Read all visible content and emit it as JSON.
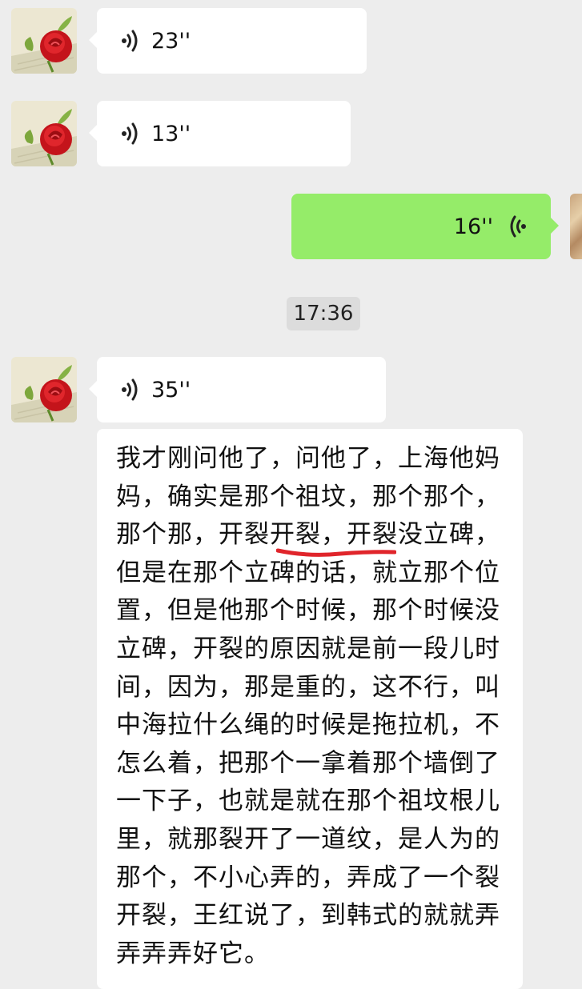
{
  "messages": [
    {
      "side": "left",
      "type": "voice",
      "duration": "23''",
      "icon": "voice-waves-icon"
    },
    {
      "side": "left",
      "type": "voice",
      "duration": "13''",
      "icon": "voice-waves-icon"
    },
    {
      "side": "right",
      "type": "voice",
      "duration": "16''",
      "icon": "voice-waves-icon"
    },
    {
      "side": "left",
      "type": "voice",
      "duration": "35''",
      "icon": "voice-waves-icon"
    }
  ],
  "timestamp": "17:36",
  "transcript": {
    "text": "我才刚问他了，问他了，上海他妈妈，确实是那个祖坟，那个那个，那个那，开裂开裂，开裂没立碑，但是在那个立碑的话，就立那个位置，但是他那个时候，那个时候没立碑，开裂的原因就是前一段儿时间，因为，那是重的，这不行，叫中海拉什么绳的时候是拖拉机，不怎么着，把那个一拿着那个墙倒了一下子，也就是就在那个祖坟根儿里，就那裂开了一道纹，是人为的那个，不小心弄的，弄成了一个裂开裂，王红说了，到韩式的就就弄弄弄弄好它。",
    "highlight_color": "#e0252b"
  },
  "colors": {
    "background": "#ededed",
    "bubble_incoming": "#ffffff",
    "bubble_outgoing": "#95ec69",
    "timestamp_bg": "#dcdcdc"
  }
}
